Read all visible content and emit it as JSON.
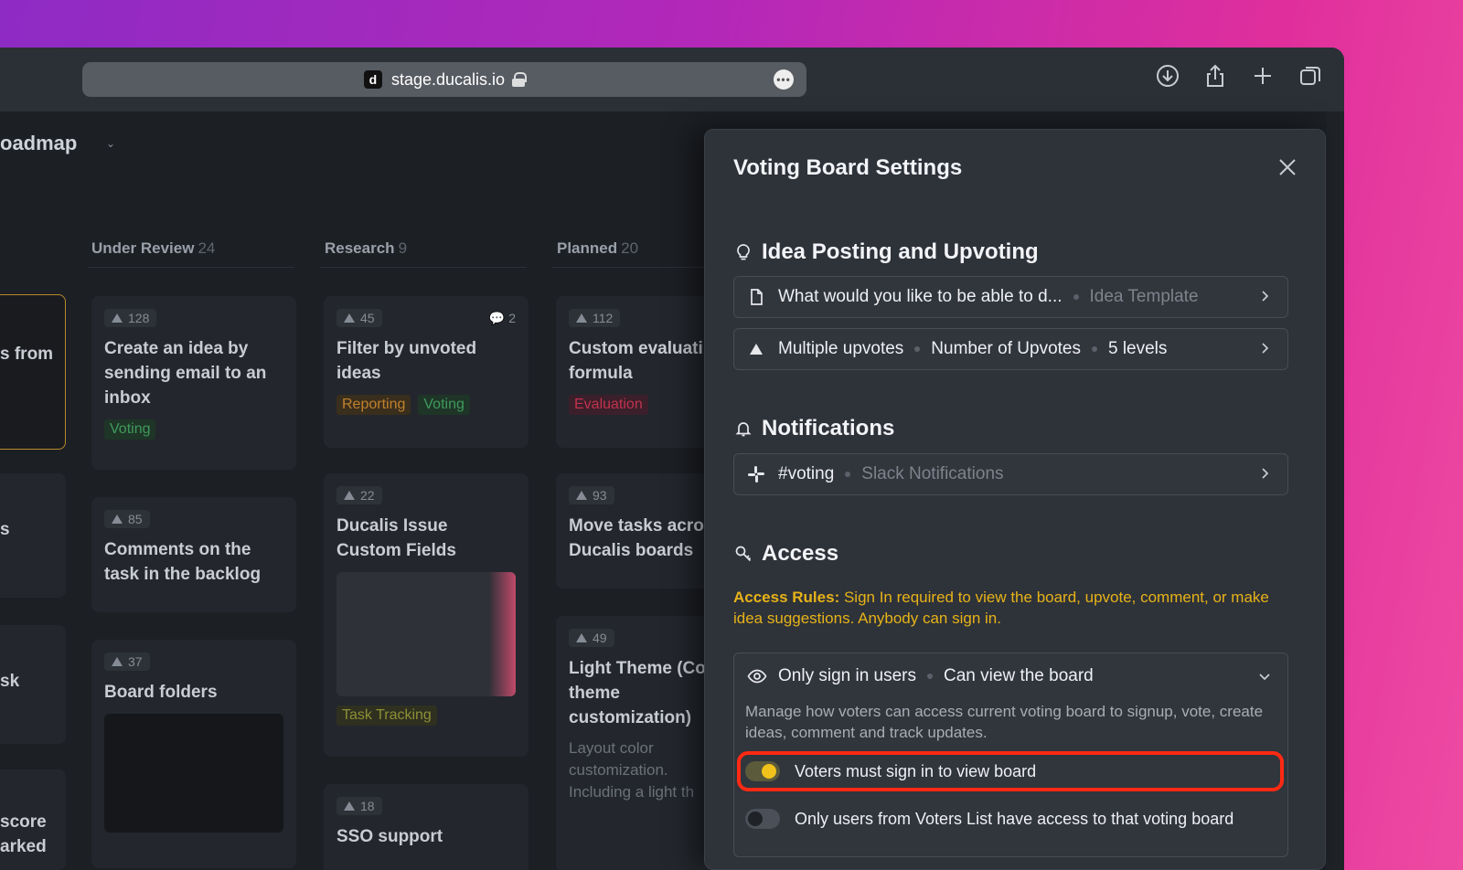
{
  "browser": {
    "favicon": "d",
    "url": "stage.ducalis.io",
    "more_label": "•••",
    "icons": [
      "download-icon",
      "share-icon",
      "new-tab-icon",
      "tabs-icon"
    ]
  },
  "board": {
    "title": "oadmap",
    "columns": [
      {
        "name": "Under Review",
        "count": "24"
      },
      {
        "name": "Research",
        "count": "9"
      },
      {
        "name": "Planned",
        "count": "20"
      }
    ],
    "partial_left": [
      "s from",
      "s",
      "sk",
      "score",
      "arked"
    ],
    "cards": {
      "c1": {
        "votes": "128",
        "title": "Create an idea by sending email to an inbox",
        "tag": "Voting"
      },
      "c2": {
        "votes": "85",
        "title": "Comments on the task in the backlog"
      },
      "c3": {
        "votes": "37",
        "title": "Board folders"
      },
      "c4": {
        "votes": "45",
        "comments": "2",
        "title": "Filter by unvoted ideas",
        "tags": [
          "Reporting",
          "Voting"
        ]
      },
      "c5": {
        "votes": "22",
        "title": "Ducalis Issue Custom Fields",
        "tag": "Task Tracking"
      },
      "c6": {
        "votes": "18",
        "title": "SSO support"
      },
      "c7": {
        "votes": "112",
        "title": "Custom evaluati formula",
        "tag": "Evaluation"
      },
      "c8": {
        "votes": "93",
        "title": "Move tasks acro Ducalis boards"
      },
      "c9": {
        "votes": "49",
        "title": "Light Theme (Co theme customization)",
        "desc": "Layout color customization. Including a light th"
      }
    }
  },
  "modal": {
    "title": "Voting Board Settings",
    "idea_section": {
      "heading": "Idea Posting and Upvoting",
      "template_row": {
        "value": "What would you like to be able to d...",
        "label": "Idea Template"
      },
      "upvote_row": {
        "value": "Multiple upvotes",
        "label": "Number of Upvotes",
        "extra": "5 levels"
      }
    },
    "notifications_section": {
      "heading": "Notifications",
      "slack_row": {
        "value": "#voting",
        "label": "Slack Notifications"
      }
    },
    "access_section": {
      "heading": "Access",
      "rules_label": "Access Rules:",
      "rules_text": " Sign In required to view the board, upvote, comment, or make idea suggestions. Anybody can sign in.",
      "select_value": "Only sign in users",
      "select_label": "Can view the board",
      "description": "Manage how voters can access current voting board to signup, vote, create ideas, comment and track updates.",
      "toggle1": {
        "label": "Voters must sign in to view board",
        "on": true
      },
      "toggle2": {
        "label": "Only users from Voters List have access to that voting board",
        "on": false
      }
    }
  },
  "colors": {
    "accent_yellow": "#f1c21b",
    "access_text": "#e7b318",
    "highlight_red": "#ff2a13"
  }
}
